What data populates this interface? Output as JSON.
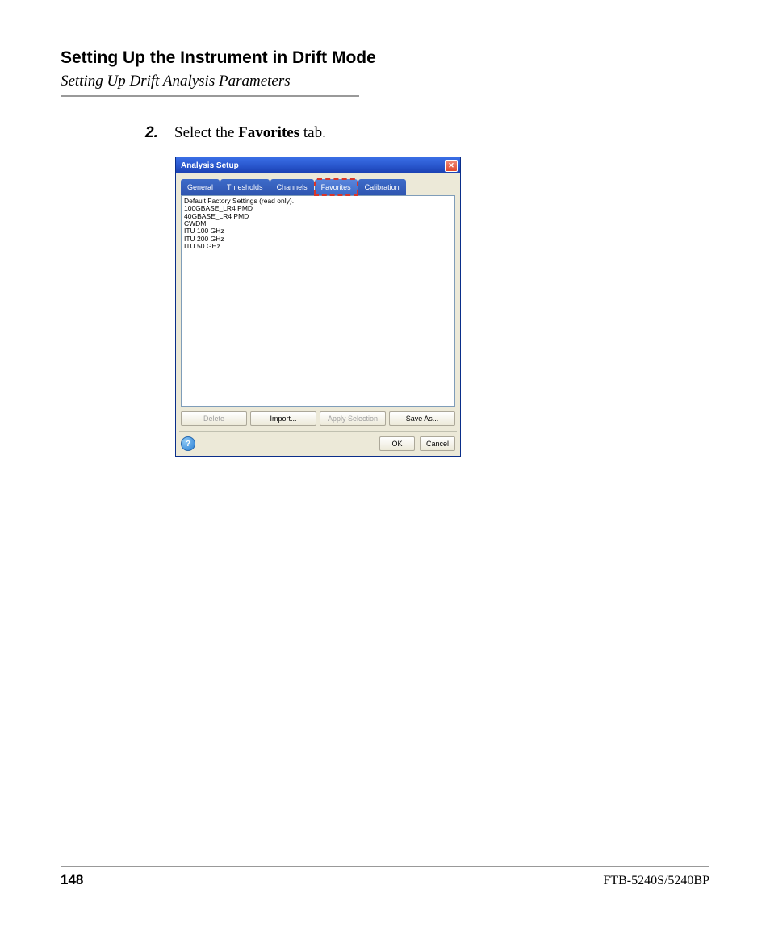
{
  "header": {
    "title": "Setting Up the Instrument in Drift Mode",
    "subtitle": "Setting Up Drift Analysis Parameters"
  },
  "step": {
    "number": "2.",
    "prefix": "Select the ",
    "bold": "Favorites",
    "suffix": " tab."
  },
  "dialog": {
    "title": "Analysis Setup",
    "tabs": [
      "General",
      "Thresholds",
      "Channels",
      "Favorites",
      "Calibration"
    ],
    "list_items": [
      "Default Factory Settings (read only).",
      "100GBASE_LR4 PMD",
      "40GBASE_LR4 PMD",
      "CWDM",
      "ITU 100 GHz",
      "ITU 200 GHz",
      "ITU 50 GHz"
    ],
    "buttons": {
      "delete": "Delete",
      "import": "Import...",
      "apply": "Apply Selection",
      "save_as": "Save As...",
      "ok": "OK",
      "cancel": "Cancel"
    },
    "help_label": "?"
  },
  "footer": {
    "page_number": "148",
    "model": "FTB-5240S/5240BP"
  }
}
